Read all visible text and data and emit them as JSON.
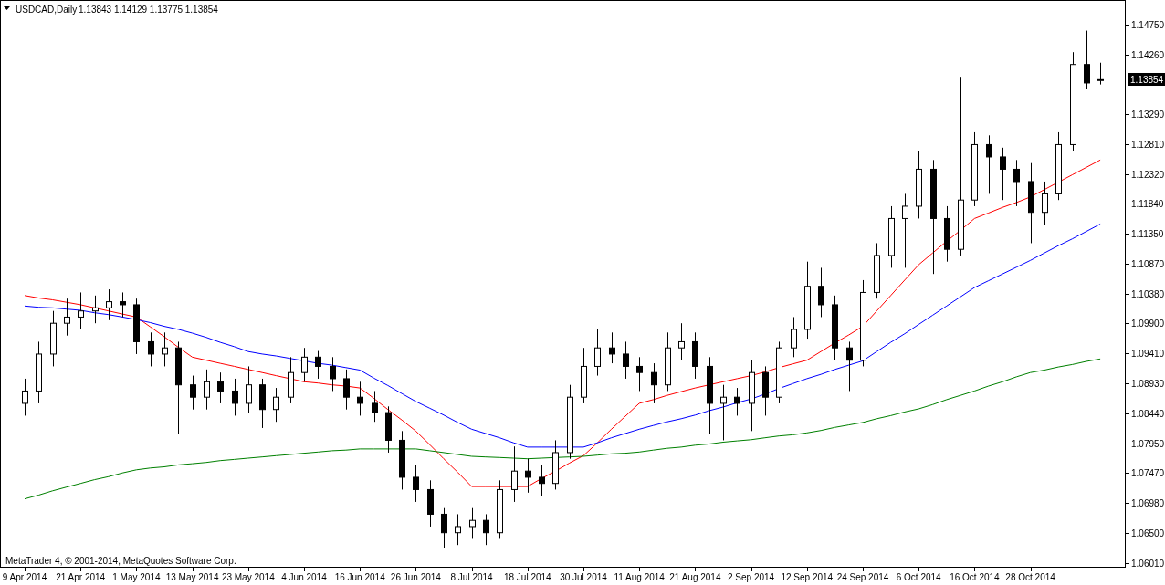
{
  "chart": {
    "symbol": "USDCAD,Daily",
    "quote": "1.13843 1.14129 1.13775 1.13854",
    "current_price": "1.13854",
    "copyright": "MetaTrader 4, © 2001-2014, MetaQuotes Software Corp.",
    "chart_data": {
      "type": "candlestick",
      "categories": [
        "9 Apr 2014",
        null,
        null,
        null,
        "21 Apr 2014",
        null,
        null,
        null,
        "1 May 2014",
        null,
        null,
        null,
        "13 May 2014",
        null,
        null,
        null,
        "23 May 2014",
        null,
        null,
        null,
        "4 Jun 2014",
        null,
        null,
        null,
        "16 Jun 2014",
        null,
        null,
        null,
        "26 Jun 2014",
        null,
        null,
        null,
        "8 Jul 2014",
        null,
        null,
        null,
        "18 Jul 2014",
        null,
        null,
        null,
        "30 Jul 2014",
        null,
        null,
        null,
        "11 Aug 2014",
        null,
        null,
        null,
        "21 Aug 2014",
        null,
        null,
        null,
        "2 Sep 2014",
        null,
        null,
        null,
        "12 Sep 2014",
        null,
        null,
        null,
        "24 Sep 2014",
        null,
        null,
        null,
        "6 Oct 2014",
        null,
        null,
        null,
        "16 Oct 2014",
        null,
        null,
        null,
        "28 Oct 2014",
        null,
        null,
        null,
        null,
        null
      ],
      "ohlc": [
        [
          1.086,
          1.09,
          1.084,
          1.088
        ],
        [
          1.088,
          1.096,
          1.086,
          1.094
        ],
        [
          1.094,
          1.101,
          1.092,
          1.099
        ],
        [
          1.099,
          1.103,
          1.097,
          1.1
        ],
        [
          1.1,
          1.104,
          1.098,
          1.101
        ],
        [
          1.101,
          1.1035,
          1.099,
          1.1015
        ],
        [
          1.1015,
          1.1045,
          1.0995,
          1.1025
        ],
        [
          1.1025,
          1.104,
          1.1,
          1.102
        ],
        [
          1.102,
          1.103,
          1.094,
          1.096
        ],
        [
          1.096,
          1.0975,
          1.092,
          1.094
        ],
        [
          1.094,
          1.0975,
          1.092,
          1.095
        ],
        [
          1.095,
          1.096,
          1.081,
          1.089
        ],
        [
          1.089,
          1.0905,
          1.085,
          1.087
        ],
        [
          1.087,
          1.0915,
          1.085,
          1.0895
        ],
        [
          1.0895,
          1.091,
          1.086,
          1.088
        ],
        [
          1.088,
          1.09,
          1.084,
          1.086
        ],
        [
          1.086,
          1.092,
          1.0845,
          1.089
        ],
        [
          1.089,
          1.09,
          1.082,
          1.085
        ],
        [
          1.085,
          1.0885,
          1.083,
          1.087
        ],
        [
          1.087,
          1.0935,
          1.086,
          1.091
        ],
        [
          1.091,
          1.095,
          1.0895,
          1.0935
        ],
        [
          1.0935,
          1.0945,
          1.09,
          1.092
        ],
        [
          1.092,
          1.0935,
          1.088,
          1.09
        ],
        [
          1.09,
          1.0915,
          1.085,
          1.087
        ],
        [
          1.087,
          1.0895,
          1.084,
          1.086
        ],
        [
          1.086,
          1.088,
          1.083,
          1.0845
        ],
        [
          1.0845,
          1.0855,
          1.078,
          1.08
        ],
        [
          1.08,
          1.0815,
          1.072,
          1.074
        ],
        [
          1.074,
          1.076,
          1.07,
          1.072
        ],
        [
          1.072,
          1.0735,
          1.066,
          1.068
        ],
        [
          1.068,
          1.069,
          1.0625,
          1.065
        ],
        [
          1.065,
          1.068,
          1.063,
          1.066
        ],
        [
          1.066,
          1.069,
          1.064,
          1.067
        ],
        [
          1.067,
          1.068,
          1.063,
          1.065
        ],
        [
          1.065,
          1.0735,
          1.064,
          1.072
        ],
        [
          1.072,
          1.079,
          1.07,
          1.075
        ],
        [
          1.075,
          1.077,
          1.0715,
          1.074
        ],
        [
          1.074,
          1.076,
          1.071,
          1.073
        ],
        [
          1.073,
          1.08,
          1.072,
          1.078
        ],
        [
          1.078,
          1.089,
          1.077,
          1.087
        ],
        [
          1.087,
          1.095,
          1.086,
          1.092
        ],
        [
          1.092,
          1.098,
          1.0905,
          1.095
        ],
        [
          1.095,
          1.0975,
          1.0925,
          1.094
        ],
        [
          1.094,
          1.096,
          1.09,
          1.092
        ],
        [
          1.092,
          1.0935,
          1.088,
          1.091
        ],
        [
          1.091,
          1.0925,
          1.086,
          1.089
        ],
        [
          1.089,
          1.0975,
          1.088,
          1.095
        ],
        [
          1.095,
          1.099,
          1.093,
          1.096
        ],
        [
          1.096,
          1.0975,
          1.09,
          1.092
        ],
        [
          1.092,
          1.0935,
          1.081,
          1.086
        ],
        [
          1.086,
          1.089,
          1.08,
          1.087
        ],
        [
          1.087,
          1.0885,
          1.084,
          1.086
        ],
        [
          1.086,
          1.093,
          1.0815,
          1.091
        ],
        [
          1.091,
          1.092,
          1.084,
          1.087
        ],
        [
          1.087,
          1.096,
          1.086,
          1.095
        ],
        [
          1.095,
          1.1,
          1.0935,
          1.098
        ],
        [
          1.098,
          1.109,
          1.0965,
          1.105
        ],
        [
          1.105,
          1.108,
          1.1,
          1.102
        ],
        [
          1.102,
          1.1035,
          1.093,
          1.095
        ],
        [
          1.095,
          1.096,
          1.088,
          1.093
        ],
        [
          1.093,
          1.106,
          1.092,
          1.104
        ],
        [
          1.104,
          1.112,
          1.103,
          1.11
        ],
        [
          1.11,
          1.118,
          1.108,
          1.116
        ],
        [
          1.116,
          1.12,
          1.108,
          1.118
        ],
        [
          1.118,
          1.127,
          1.116,
          1.124
        ],
        [
          1.124,
          1.1255,
          1.107,
          1.116
        ],
        [
          1.116,
          1.118,
          1.109,
          1.111
        ],
        [
          1.111,
          1.139,
          1.11,
          1.119
        ],
        [
          1.119,
          1.13,
          1.118,
          1.128
        ],
        [
          1.128,
          1.1295,
          1.12,
          1.126
        ],
        [
          1.126,
          1.1275,
          1.119,
          1.124
        ],
        [
          1.124,
          1.1255,
          1.118,
          1.122
        ],
        [
          1.122,
          1.125,
          1.112,
          1.117
        ],
        [
          1.117,
          1.122,
          1.115,
          1.12
        ],
        [
          1.12,
          1.13,
          1.119,
          1.128
        ],
        [
          1.128,
          1.143,
          1.127,
          1.141
        ],
        [
          1.141,
          1.1465,
          1.137,
          1.138
        ],
        [
          1.13843,
          1.14129,
          1.13775,
          1.13854
        ]
      ],
      "series": [
        {
          "type": "line",
          "color": "#ff0000",
          "values": [
            1.1035,
            1.1031,
            1.1028,
            1.1024,
            1.102,
            1.1015,
            1.101,
            1.1005,
            1.1,
            1.0984,
            1.0968,
            1.0951,
            1.0935,
            1.093,
            1.0925,
            1.092,
            1.0915,
            1.091,
            1.0905,
            1.09,
            1.0895,
            1.0893,
            1.089,
            1.0888,
            1.0885,
            1.0868,
            1.085,
            1.0833,
            1.0815,
            1.0793,
            1.077,
            1.0748,
            1.0725,
            1.0725,
            1.0725,
            1.0725,
            1.0725,
            1.0738,
            1.075,
            1.0763,
            1.0775,
            1.0796,
            1.0818,
            1.0839,
            1.086,
            1.0866,
            1.0873,
            1.0879,
            1.0885,
            1.089,
            1.0895,
            1.09,
            1.0905,
            1.0911,
            1.0918,
            1.0924,
            1.093,
            1.0944,
            1.0958,
            1.0971,
            1.0985,
            1.101,
            1.1035,
            1.106,
            1.1085,
            1.1104,
            1.1123,
            1.1141,
            1.116,
            1.1169,
            1.1178,
            1.1186,
            1.1195,
            1.1207,
            1.1219,
            1.1231,
            1.1243,
            1.1255
          ]
        },
        {
          "type": "line",
          "color": "#0000ff",
          "values": [
            1.1018,
            1.1016,
            1.1015,
            1.1013,
            1.1011,
            1.1007,
            1.1004,
            1.1,
            1.0996,
            1.0991,
            1.0985,
            1.098,
            1.0974,
            1.0967,
            1.0959,
            1.0952,
            1.0944,
            1.094,
            1.0937,
            1.0933,
            1.0929,
            1.0925,
            1.0922,
            1.0918,
            1.0914,
            1.0901,
            1.0889,
            1.0876,
            1.0863,
            1.0852,
            1.0841,
            1.0829,
            1.0818,
            1.0811,
            1.0804,
            1.0796,
            1.0789,
            1.0789,
            1.0789,
            1.0789,
            1.0789,
            1.0796,
            1.0804,
            1.0811,
            1.0818,
            1.0824,
            1.083,
            1.0835,
            1.0841,
            1.0848,
            1.0854,
            1.0861,
            1.0867,
            1.0875,
            1.0884,
            1.0892,
            1.09,
            1.0907,
            1.0915,
            1.0922,
            1.0929,
            1.0944,
            1.0959,
            1.0973,
            1.0988,
            1.1003,
            1.1018,
            1.1033,
            1.1048,
            1.1059,
            1.107,
            1.1081,
            1.1092,
            1.1104,
            1.1116,
            1.1127,
            1.1139,
            1.1151
          ]
        },
        {
          "type": "line",
          "color": "#008000",
          "values": [
            1.0705,
            1.0711,
            1.0718,
            1.0724,
            1.073,
            1.0736,
            1.0741,
            1.0747,
            1.0752,
            1.0755,
            1.0757,
            1.076,
            1.0762,
            1.0764,
            1.0767,
            1.0769,
            1.0771,
            1.0773,
            1.0775,
            1.0777,
            1.0779,
            1.0781,
            1.0783,
            1.0784,
            1.0786,
            1.0786,
            1.0786,
            1.0786,
            1.0786,
            1.0783,
            1.078,
            1.0777,
            1.0774,
            1.0773,
            1.0772,
            1.0771,
            1.077,
            1.0771,
            1.0772,
            1.0773,
            1.0774,
            1.0776,
            1.0778,
            1.0779,
            1.0781,
            1.0784,
            1.0787,
            1.0789,
            1.0792,
            1.0794,
            1.0797,
            1.0799,
            1.0801,
            1.0804,
            1.0807,
            1.0809,
            1.0812,
            1.0816,
            1.0821,
            1.0825,
            1.0829,
            1.0835,
            1.084,
            1.0846,
            1.0851,
            1.0858,
            1.0866,
            1.0873,
            1.088,
            1.0888,
            1.0895,
            1.0903,
            1.091,
            1.0914,
            1.0919,
            1.0923,
            1.0928,
            1.0932
          ]
        }
      ],
      "ylim": [
        1.0594,
        1.1514
      ],
      "yticks": [
        {
          "value": 1.1475,
          "label": "1.14750"
        },
        {
          "value": 1.1426,
          "label": "1.14260"
        },
        {
          "value": 1.1329,
          "label": "1.13290"
        },
        {
          "value": 1.1281,
          "label": "1.12810"
        },
        {
          "value": 1.1232,
          "label": "1.12320"
        },
        {
          "value": 1.1184,
          "label": "1.11840"
        },
        {
          "value": 1.1135,
          "label": "1.11350"
        },
        {
          "value": 1.1087,
          "label": "1.10870"
        },
        {
          "value": 1.1038,
          "label": "1.10380"
        },
        {
          "value": 1.099,
          "label": "1.09900"
        },
        {
          "value": 1.0941,
          "label": "1.09410"
        },
        {
          "value": 1.0893,
          "label": "1.08930"
        },
        {
          "value": 1.0844,
          "label": "1.08440"
        },
        {
          "value": 1.0795,
          "label": "1.07950"
        },
        {
          "value": 1.0747,
          "label": "1.07470"
        },
        {
          "value": 1.0698,
          "label": "1.06980"
        },
        {
          "value": 1.065,
          "label": "1.06500"
        },
        {
          "value": 1.0601,
          "label": "1.06010"
        }
      ]
    }
  }
}
